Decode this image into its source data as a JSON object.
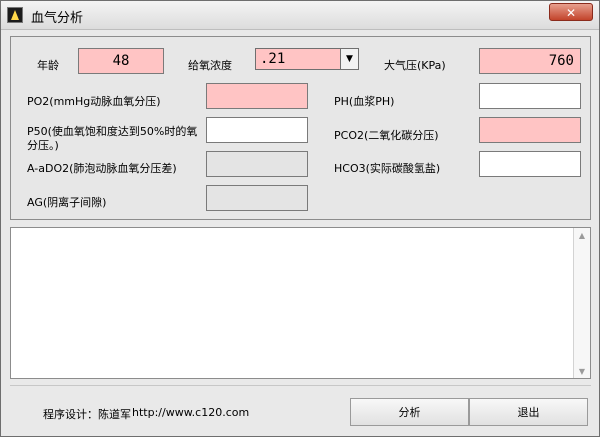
{
  "window": {
    "title": "血气分析",
    "close_icon": "close-icon",
    "app_icon": "app-icon"
  },
  "form": {
    "age_label": "年龄",
    "age_value": "48",
    "oxygen_label": "给氧浓度",
    "oxygen_value": ".21",
    "pressure_label": "大气压(KPa)",
    "pressure_value": "760",
    "po2_label": "PO2(mmHg动脉血氧分压)",
    "po2_value": "",
    "ph_label": "PH(血浆PH)",
    "ph_value": "",
    "p50_label": "P50(使血氧饱和度达到50%时的氧分压。)",
    "p50_value": "",
    "pco2_label": "PCO2(二氧化碳分压)",
    "pco2_value": "",
    "aado2_label": "A-aDO2(肺泡动脉血氧分压差)",
    "aado2_value": "",
    "hco3_label": "HCO3(实际碳酸氢盐)",
    "hco3_value": "",
    "ag_label": "AG(阴离子间隙)",
    "ag_value": ""
  },
  "output": {
    "text": ""
  },
  "footer": {
    "designer_label": "程序设计：陈道军",
    "url": "http://www.c120.com",
    "analyze_button": "分析",
    "exit_button": "退出"
  },
  "colors": {
    "required_field": "#ffc4c4",
    "disabled_field": "#e4e4e4",
    "input_field": "#ffffff"
  }
}
